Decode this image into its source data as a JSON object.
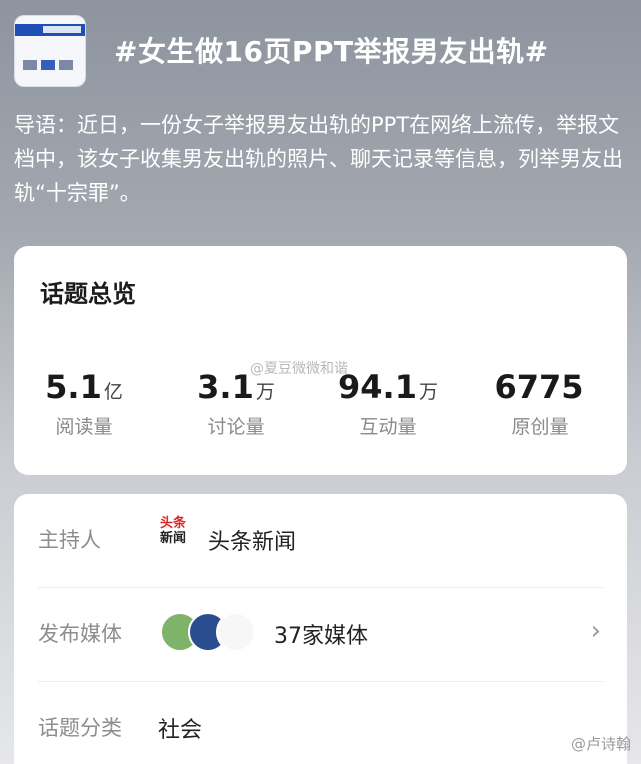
{
  "header": {
    "title": "#女生做16页PPT举报男友出轨#"
  },
  "intro": {
    "text": "导语：近日，一份女子举报男友出轨的PPT在网络上流传，举报文档中，该女子收集男友出轨的照片、聊天记录等信息，列举男友出轨“十宗罪”。"
  },
  "overview": {
    "title": "话题总览",
    "stats": [
      {
        "number": "5.1",
        "unit": "亿",
        "label": "阅读量"
      },
      {
        "number": "3.1",
        "unit": "万",
        "label": "讨论量"
      },
      {
        "number": "94.1",
        "unit": "万",
        "label": "互动量"
      },
      {
        "number": "6775",
        "unit": "",
        "label": "原创量"
      }
    ],
    "watermark": "@夏豆微微和谐"
  },
  "info": {
    "host_label": "主持人",
    "host_logo_top": "头条",
    "host_logo_bottom": "新闻",
    "host_name": "头条新闻",
    "media_label": "发布媒体",
    "media_count": "37家媒体",
    "category_label": "话题分类",
    "category_value": "社会"
  },
  "watermark_bottom": "@卢诗翰"
}
